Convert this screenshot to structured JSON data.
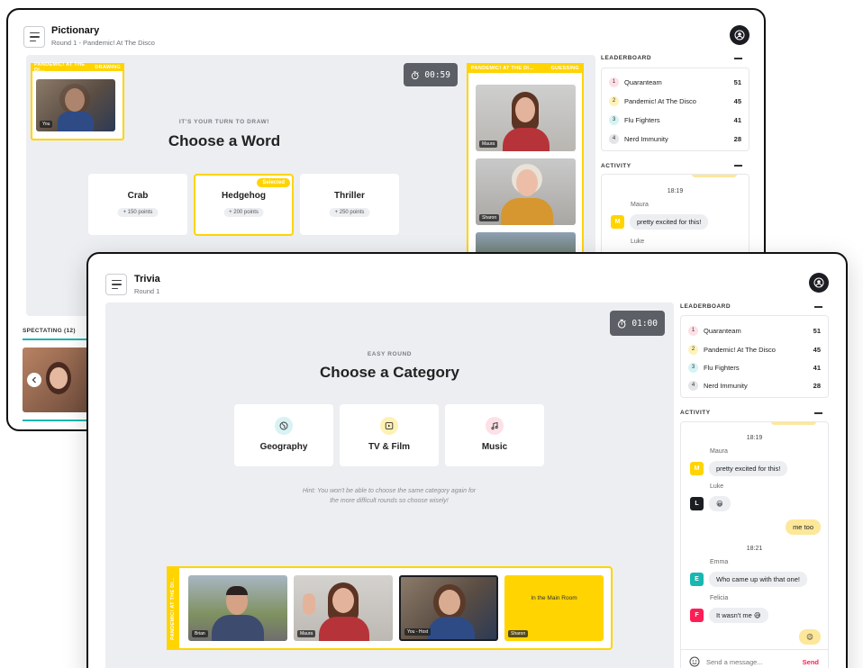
{
  "pictionary": {
    "title": "Pictionary",
    "subtitle": "Round 1 - Pandemic! At The Disco",
    "timer": "00:59",
    "turn_label": "IT'S YOUR TURN TO DRAW!",
    "heading": "Choose a Word",
    "team_left": "PANDEMIC! AT THE DI...",
    "team_left_role": "DRAWING",
    "team_right": "PANDEMIC! AT THE DI...",
    "team_right_role": "GUESSING",
    "self_label": "You",
    "words": [
      {
        "word": "Crab",
        "points": "+ 150 points"
      },
      {
        "word": "Hedgehog",
        "points": "+ 200 points",
        "badge": "Selected"
      },
      {
        "word": "Thriller",
        "points": "+ 250 points"
      }
    ],
    "guessers": [
      {
        "name": "Maura"
      },
      {
        "name": "Sharon"
      }
    ],
    "spectating": "SPECTATING (12)",
    "leaderboard": {
      "title": "LEADERBOARD",
      "rows": [
        {
          "rank": "1",
          "name": "Quaranteam",
          "score": "51",
          "color": "#fde0e6"
        },
        {
          "rank": "2",
          "name": "Pandemic! At The Disco",
          "score": "45",
          "color": "#fff2b8"
        },
        {
          "rank": "3",
          "name": "Flu Fighters",
          "score": "41",
          "color": "#d6f3f4"
        },
        {
          "rank": "4",
          "name": "Nerd Immunity",
          "score": "28",
          "color": "#e4e5e8"
        }
      ]
    },
    "activity": {
      "title": "ACTIVITY",
      "time": "18:19",
      "msg1_name": "Maura",
      "msg1_avatar": "M",
      "msg1_text": "pretty excited for this!",
      "msg2_name": "Luke"
    }
  },
  "trivia": {
    "title": "Trivia",
    "subtitle": "Round 1",
    "timer": "01:00",
    "round_label": "EASY ROUND",
    "heading": "Choose a Category",
    "categories": [
      {
        "label": "Geography",
        "icon": "globe-icon",
        "bg": "#d9f2f4"
      },
      {
        "label": "TV & Film",
        "icon": "play-icon",
        "bg": "#fff1b3"
      },
      {
        "label": "Music",
        "icon": "music-note-icon",
        "bg": "#fde1e7"
      }
    ],
    "hint": "Hint: You won't be able to choose the same category again for the more difficult rounds so choose wisely!",
    "team_label": "PANDEMIC! AT THE DI...",
    "participants": [
      {
        "name": "Brian"
      },
      {
        "name": "Maura"
      },
      {
        "name": "You - Host"
      },
      {
        "name": "Sharon",
        "status": "In the Main Room"
      }
    ],
    "leaderboard": {
      "title": "LEADERBOARD",
      "rows": [
        {
          "rank": "1",
          "name": "Quaranteam",
          "score": "51"
        },
        {
          "rank": "2",
          "name": "Pandemic! At The Disco",
          "score": "45"
        },
        {
          "rank": "3",
          "name": "Flu Fighters",
          "score": "41"
        },
        {
          "rank": "4",
          "name": "Nerd Immunity",
          "score": "28"
        }
      ]
    },
    "activity": {
      "title": "ACTIVITY",
      "time1": "18:19",
      "time2": "18:21",
      "messages": [
        {
          "name": "Maura",
          "avatar": "M",
          "color": "#ffd400",
          "text": "pretty excited for this!"
        },
        {
          "name": "Luke",
          "avatar": "L",
          "color": "#1b1d22",
          "text": "😀"
        },
        {
          "self": true,
          "text": "me too"
        },
        {
          "name": "Emma",
          "avatar": "E",
          "color": "#18b7b0",
          "text": "Who came up with that one!"
        },
        {
          "name": "Felicia",
          "avatar": "F",
          "color": "#ff1d55",
          "text": "It wasn't me 😅"
        },
        {
          "self": true,
          "text": "😉"
        }
      ],
      "input_placeholder": "Send a message...",
      "send_label": "Send"
    }
  }
}
